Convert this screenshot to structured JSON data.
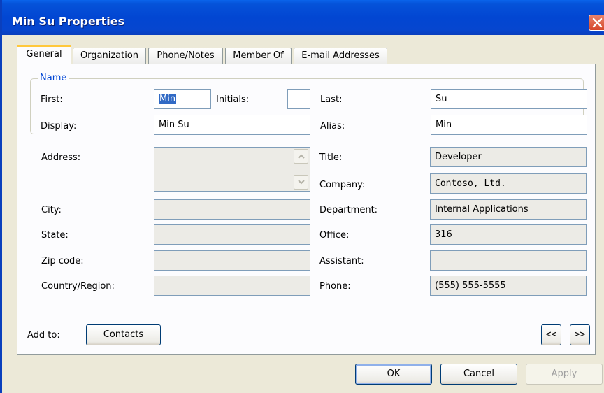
{
  "window": {
    "title": "Min Su Properties"
  },
  "tabs": [
    {
      "label": "General"
    },
    {
      "label": "Organization"
    },
    {
      "label": "Phone/Notes"
    },
    {
      "label": "Member Of"
    },
    {
      "label": "E-mail Addresses"
    }
  ],
  "active_tab": "General",
  "name_group": {
    "legend": "Name",
    "first_label": "First:",
    "first_value": "Min",
    "initials_label": "Initials:",
    "initials_value": "",
    "last_label": "Last:",
    "last_value": "Su",
    "display_label": "Display:",
    "display_value": "Min Su",
    "alias_label": "Alias:",
    "alias_value": "Min"
  },
  "address": {
    "address_label": "Address:",
    "address_value": "",
    "city_label": "City:",
    "city_value": "",
    "state_label": "State:",
    "state_value": "",
    "zip_label": "Zip code:",
    "zip_value": "",
    "country_label": "Country/Region:",
    "country_value": ""
  },
  "organization": {
    "title_label": "Title:",
    "title_value": "Developer",
    "company_label": "Company:",
    "company_value": "Contoso, Ltd.",
    "department_label": "Department:",
    "department_value": "Internal Applications",
    "office_label": "Office:",
    "office_value": "316",
    "assistant_label": "Assistant:",
    "assistant_value": "",
    "phone_label": "Phone:",
    "phone_value": "(555) 555-5555"
  },
  "add_to": {
    "label": "Add to:",
    "button": "Contacts"
  },
  "nav": {
    "prev": "<<",
    "next": ">>"
  },
  "buttons": {
    "ok": "OK",
    "cancel": "Cancel",
    "apply": "Apply"
  },
  "colors": {
    "titlebar": "#0246d2",
    "dialog_face": "#ece9d8",
    "tab_highlight": "#ffc83c",
    "group_legend": "#0046d5",
    "selection": "#316ac5"
  },
  "icons": {
    "close": "close-icon",
    "scroll_up": "scroll-up-arrow-icon",
    "scroll_down": "scroll-down-arrow-icon"
  }
}
